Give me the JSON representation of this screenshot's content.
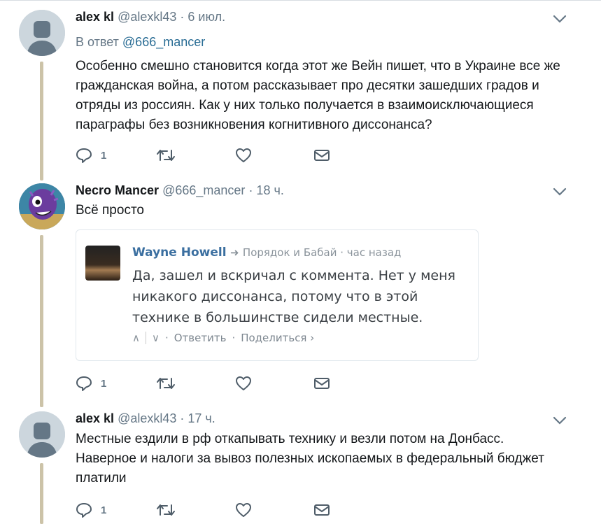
{
  "tweets": [
    {
      "name": "alex kl",
      "handle": "@alexkl43",
      "time": "· 6 июл.",
      "reply_prefix": "В ответ",
      "reply_mention": "@666_mancer",
      "text": "Особенно смешно становится когда этот же Вейн пишет, что в Украине все же гражданская война, а потом рассказывает про десятки зашедших градов и отряды из россиян. Как у них только получается в взаимоисключающиеся параграфы без возникновения когнитивного диссонанса?",
      "replies": "1"
    },
    {
      "name": "Necro Mancer",
      "handle": "@666_mancer",
      "time": "· 18 ч.",
      "text": "Всё просто",
      "replies": "1",
      "quote": {
        "author": "Wayne Howell",
        "arrow": "➜",
        "meta": "Порядок и Бабай · час назад",
        "text": "Да, зашел и вскричал с коммента. Нет у меня никакого диссонанса, потому что в этой технике в большинстве сидели местные.",
        "up": "∧",
        "down": "∨",
        "reply_label": "Ответить",
        "share_label": "Поделиться ›"
      }
    },
    {
      "name": "alex kl",
      "handle": "@alexkl43",
      "time": "· 17 ч.",
      "text": "Местные ездили в рф откапывать технику и везли потом на Донбасс. Наверное и налоги за вывоз полезных ископаемых в федеральный бюджет платили",
      "replies": "1"
    }
  ],
  "icons": {
    "reply": "reply-icon",
    "retweet": "retweet-icon",
    "like": "heart-icon",
    "dm": "envelope-icon",
    "caret": "chevron-down-icon"
  },
  "colors": {
    "text": "#14171a",
    "secondary": "#657786",
    "mention": "#2a6d95",
    "thread_line": "#ccc3a8",
    "avatar_default": "#ccd6dd"
  }
}
